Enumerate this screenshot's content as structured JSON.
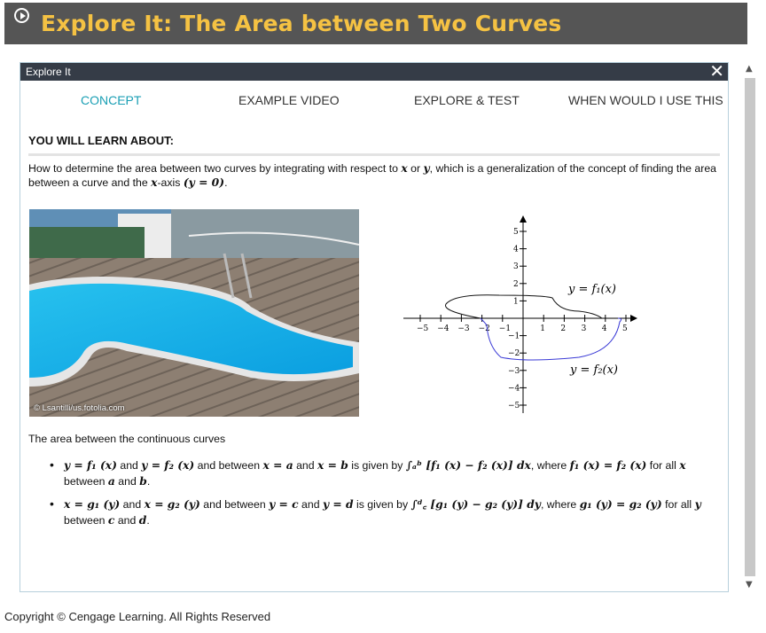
{
  "header": {
    "title": "Explore It: The Area between Two Curves",
    "icon": "play-circle-icon",
    "title_color": "#f5c243"
  },
  "panel": {
    "title": "Explore It",
    "close_label": "✕"
  },
  "tabs": [
    {
      "label": "CONCEPT",
      "active": true
    },
    {
      "label": "EXAMPLE VIDEO",
      "active": false
    },
    {
      "label": "EXPLORE & TEST",
      "active": false
    },
    {
      "label": "WHEN WOULD I USE THIS",
      "active": false
    }
  ],
  "accent_color": "#1a9fb4",
  "learn": {
    "heading": "YOU WILL LEARN ABOUT:",
    "intro_1": "How to determine the area between two curves by integrating with respect to ",
    "x": "x",
    "or": " or ",
    "y": "y",
    "intro_2": ", which is a generalization of the concept of finding the area between a curve and the ",
    "intro_3": "-axis ",
    "y_eq_0": "(y = 0)",
    "period": "."
  },
  "photo": {
    "credit": "© Lsantilli/us.fotolia.com"
  },
  "graph": {
    "x_ticks": [
      "−5",
      "−4",
      "−3",
      "−2",
      "−1",
      "1",
      "2",
      "3",
      "4",
      "5"
    ],
    "y_ticks_pos": [
      "1",
      "2",
      "3",
      "4",
      "5"
    ],
    "y_ticks_neg": [
      "−1",
      "−2",
      "−3",
      "−4",
      "−5"
    ],
    "curve1_label": "y = f₁(x)",
    "curve2_label": "y = f₂(x)",
    "curve1_color": "#111111",
    "curve2_color": "#3a3ad6"
  },
  "area": {
    "text": "The area between the continuous curves",
    "b1_a": "y = f₁ (x)",
    "b1_and1": " and ",
    "b1_b": "y = f₂ (x)",
    "b1_c": " and between ",
    "b1_d": "x = a",
    "b1_and2": " and ",
    "b1_e": "x = b",
    "b1_f": " is given by ",
    "b1_int": "∫ₐᵇ [f₁ (x) − f₂ (x)] dx",
    "b1_g": ", where ",
    "b1_h": "f₁ (x) = f₂ (x)",
    "b1_i": " for all ",
    "b1_x": "x",
    "b1_j": " between ",
    "b1_a2": "a",
    "b1_k": " and ",
    "b1_b2": "b",
    "b1_end": ".",
    "b2_a": "x = g₁ (y)",
    "b2_and1": " and ",
    "b2_b": "x = g₂ (y)",
    "b2_c": " and between ",
    "b2_d": "y = c",
    "b2_and2": " and ",
    "b2_e": "y = d",
    "b2_f": " is given by ",
    "b2_int": "∫ᵈ꜀ [g₁ (y) − g₂ (y)] dy",
    "b2_g": ", where ",
    "b2_h": "g₁ (y) = g₂ (y)",
    "b2_i": " for all ",
    "b2_y": "y",
    "b2_j": " between ",
    "b2_c2": "c",
    "b2_k": " and ",
    "b2_d2": "d",
    "b2_end": "."
  },
  "footer": {
    "copyright": "Copyright © Cengage Learning. All Rights Reserved"
  }
}
